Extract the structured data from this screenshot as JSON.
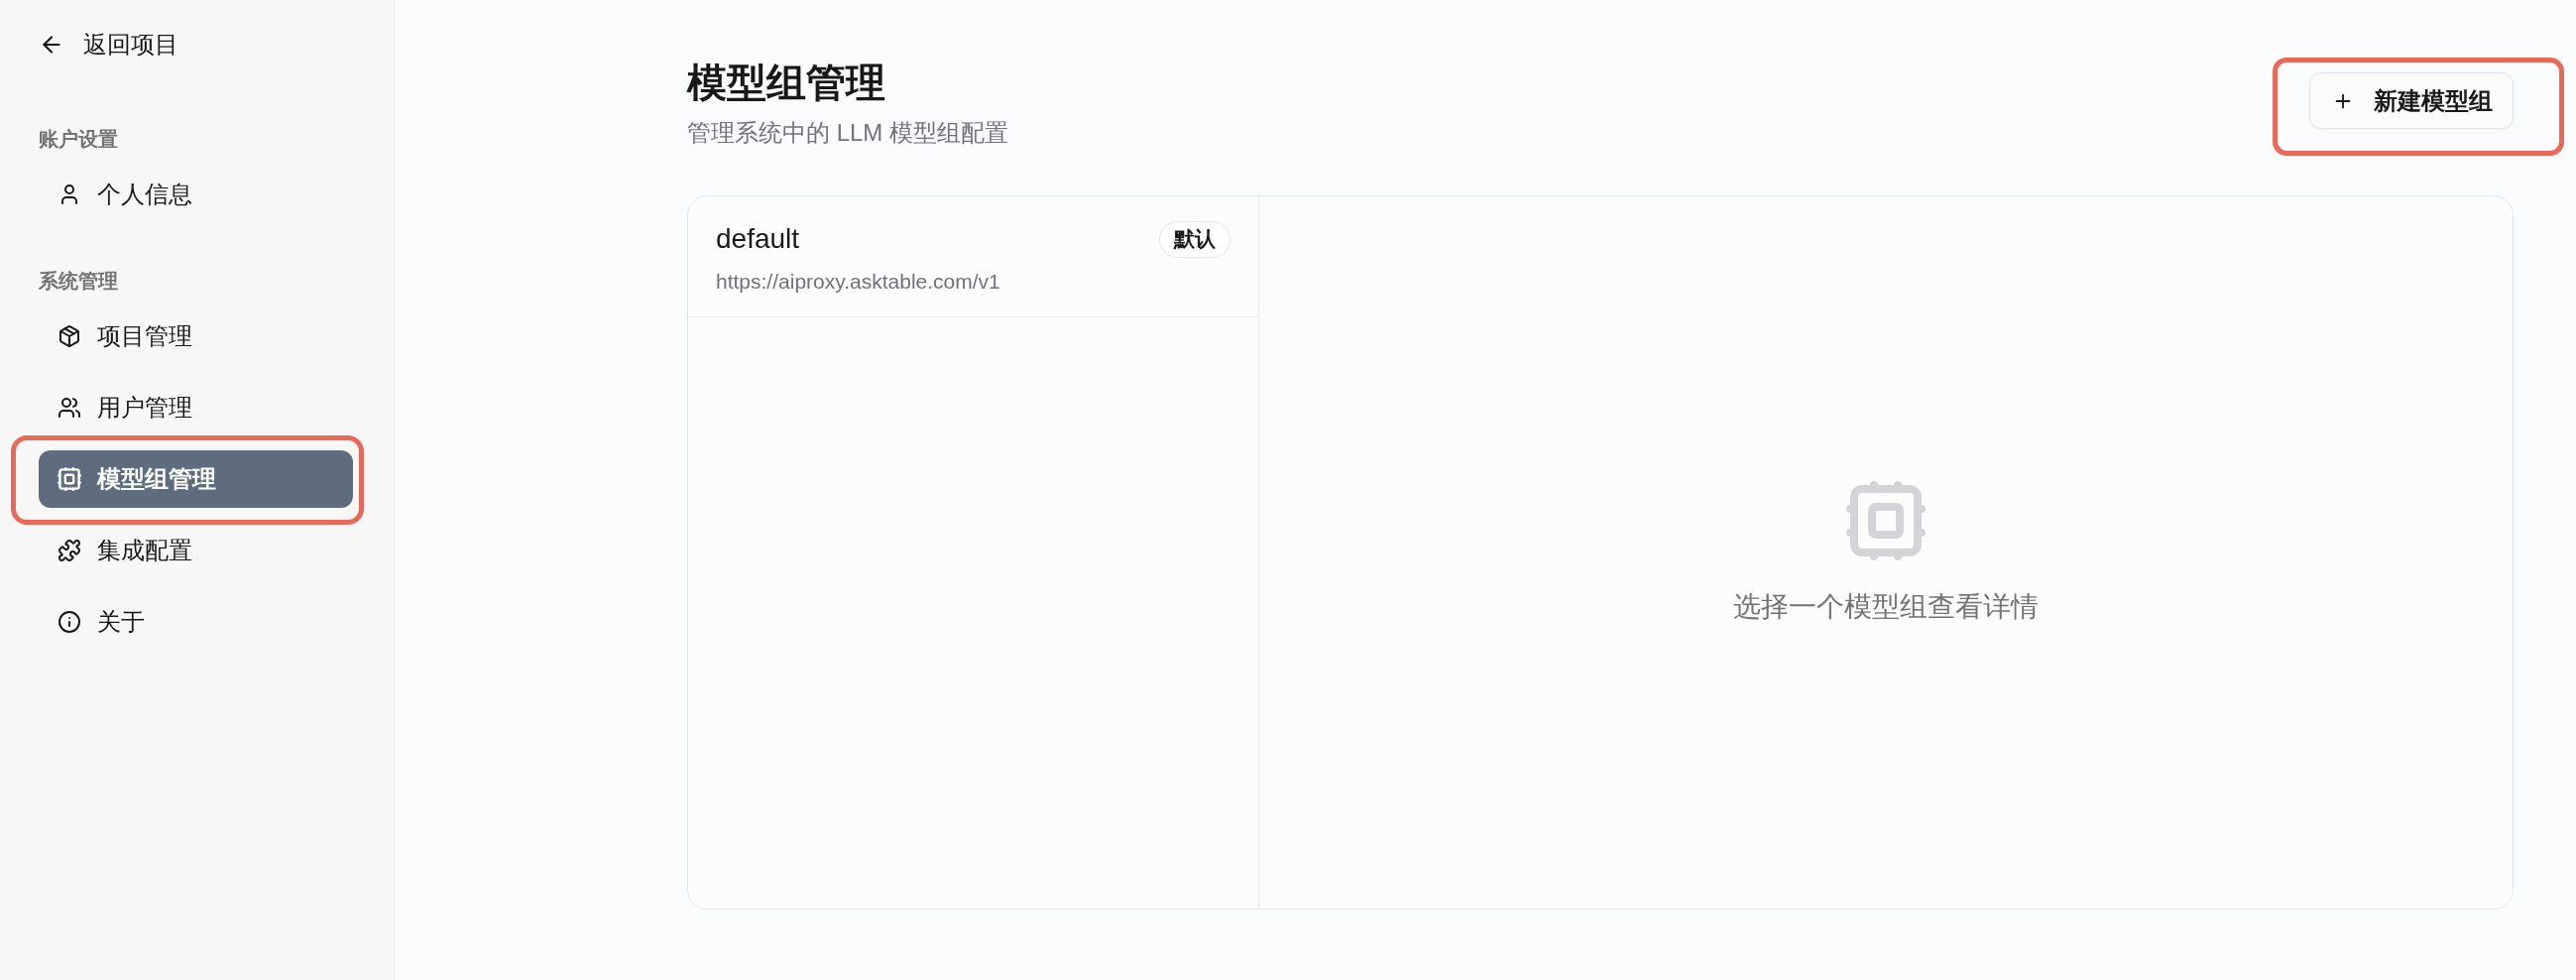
{
  "sidebar": {
    "back_link": {
      "label": "返回项目"
    },
    "sections": [
      {
        "title": "账户设置",
        "items": [
          {
            "kind": "profile",
            "label": "个人信息",
            "selected": false,
            "highlighted": false
          }
        ]
      },
      {
        "title": "系统管理",
        "items": [
          {
            "kind": "projects",
            "label": "项目管理",
            "selected": false,
            "highlighted": false
          },
          {
            "kind": "users",
            "label": "用户管理",
            "selected": false,
            "highlighted": false
          },
          {
            "kind": "model-groups",
            "label": "模型组管理",
            "selected": true,
            "highlighted": true
          },
          {
            "kind": "integrations",
            "label": "集成配置",
            "selected": false,
            "highlighted": false
          },
          {
            "kind": "about",
            "label": "关于",
            "selected": false,
            "highlighted": false
          }
        ]
      }
    ]
  },
  "header": {
    "title": "模型组管理",
    "subtitle": "管理系统中的 LLM 模型组配置",
    "new_button": {
      "label": "新建模型组",
      "highlighted": true
    }
  },
  "model_groups": [
    {
      "name": "default",
      "url": "https://aiproxy.asktable.com/v1",
      "badge": "默认",
      "selected": false
    }
  ],
  "empty_state": {
    "message": "选择一个模型组查看详情"
  }
}
